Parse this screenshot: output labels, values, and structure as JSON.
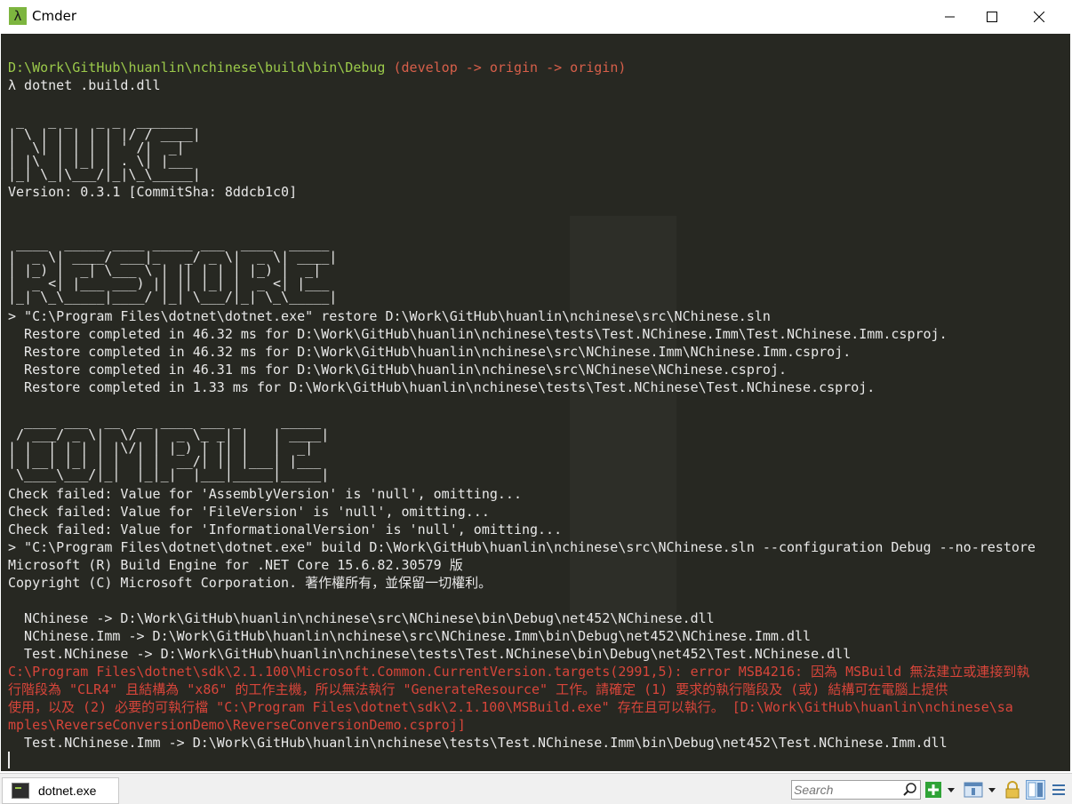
{
  "window": {
    "title": "Cmder",
    "icon_glyph": "λ",
    "accent": "#7db53f"
  },
  "terminal": {
    "prompt_path": "D:\\Work\\GitHub\\huanlin\\nchinese\\build\\bin\\Debug",
    "prompt_git": " (develop -> origin -> origin)",
    "command": "λ dotnet .build.dll",
    "banner_nuke": [
      " _   _ _   _ _  _______",
      "| \\ | | | | | |/ / ____|",
      "|  \\| | | | | ' /|  _|",
      "| |\\  | |_| | . \\| |___",
      "|_| \\_|\\___/|_|\\_\\_____|"
    ],
    "version": "Version: 0.3.1 [CommitSha: 8ddcb1c0]",
    "banner_restore": [
      " ____  _____ ____ _____ ___  ____  _____",
      "|  _ \\| ____/ ___|_   _/ _ \\|  _ \\| ____|",
      "| |_) |  _| \\___ \\ | || | | | |_) |  _|",
      "|  _ <| |___ ___) || || |_| |  _ <| |___",
      "|_| \\_\\_____|____/ |_| \\___/|_| \\_\\_____|"
    ],
    "restore_lines": [
      "> \"C:\\Program Files\\dotnet\\dotnet.exe\" restore D:\\Work\\GitHub\\huanlin\\nchinese\\src\\NChinese.sln",
      "  Restore completed in 46.32 ms for D:\\Work\\GitHub\\huanlin\\nchinese\\tests\\Test.NChinese.Imm\\Test.NChinese.Imm.csproj.",
      "  Restore completed in 46.32 ms for D:\\Work\\GitHub\\huanlin\\nchinese\\src\\NChinese.Imm\\NChinese.Imm.csproj.",
      "  Restore completed in 46.31 ms for D:\\Work\\GitHub\\huanlin\\nchinese\\src\\NChinese\\NChinese.csproj.",
      "  Restore completed in 1.33 ms for D:\\Work\\GitHub\\huanlin\\nchinese\\tests\\Test.NChinese\\Test.NChinese.csproj."
    ],
    "banner_compile": [
      "  ____ ___  __  __ ____ ___ _     _____",
      " / ___/ _ \\|  \\/  |  _ \\_ _| |   | ____|",
      "| |  | | | | |\\/| | |_) | || |   |  _|",
      "| |__| |_| | |  | |  __/| || |___| |___",
      " \\____\\___/|_|  |_|_|  |___|_____|_____|"
    ],
    "compile_lines": [
      "Check failed: Value for 'AssemblyVersion' is 'null', omitting...",
      "Check failed: Value for 'FileVersion' is 'null', omitting...",
      "Check failed: Value for 'InformationalVersion' is 'null', omitting...",
      "> \"C:\\Program Files\\dotnet\\dotnet.exe\" build D:\\Work\\GitHub\\huanlin\\nchinese\\src\\NChinese.sln --configuration Debug --no-restore",
      "Microsoft (R) Build Engine for .NET Core 15.6.82.30579 版",
      "Copyright (C) Microsoft Corporation. 著作權所有，並保留一切權利。"
    ],
    "output_lines": [
      "  NChinese -> D:\\Work\\GitHub\\huanlin\\nchinese\\src\\NChinese\\bin\\Debug\\net452\\NChinese.dll",
      "  NChinese.Imm -> D:\\Work\\GitHub\\huanlin\\nchinese\\src\\NChinese.Imm\\bin\\Debug\\net452\\NChinese.Imm.dll",
      "  Test.NChinese -> D:\\Work\\GitHub\\huanlin\\nchinese\\tests\\Test.NChinese\\bin\\Debug\\net452\\Test.NChinese.dll"
    ],
    "error_lines": [
      "C:\\Program Files\\dotnet\\sdk\\2.1.100\\Microsoft.Common.CurrentVersion.targets(2991,5): error MSB4216: 因為 MSBuild 無法建立或連接到執",
      "行階段為 \"CLR4\" 且結構為 \"x86\" 的工作主機，所以無法執行 \"GenerateResource\" 工作。請確定 (1) 要求的執行階段及 (或) 結構可在電腦上提供",
      "使用，以及 (2) 必要的可執行檔 \"C:\\Program Files\\dotnet\\sdk\\2.1.100\\MSBuild.exe\" 存在且可以執行。 [D:\\Work\\GitHub\\huanlin\\nchinese\\sa",
      "mples\\ReverseConversionDemo\\ReverseConversionDemo.csproj]"
    ],
    "final_line": "  Test.NChinese.Imm -> D:\\Work\\GitHub\\huanlin\\nchinese\\tests\\Test.NChinese.Imm\\bin\\Debug\\net452\\Test.NChinese.Imm.dll",
    "colors": {
      "background": "#272822",
      "text": "#e8e8e8",
      "path": "#9bc94a",
      "git": "#d75f4a",
      "error": "#d7453a"
    }
  },
  "statusbar": {
    "tab_label": "dotnet.exe",
    "search_placeholder": "Search"
  }
}
